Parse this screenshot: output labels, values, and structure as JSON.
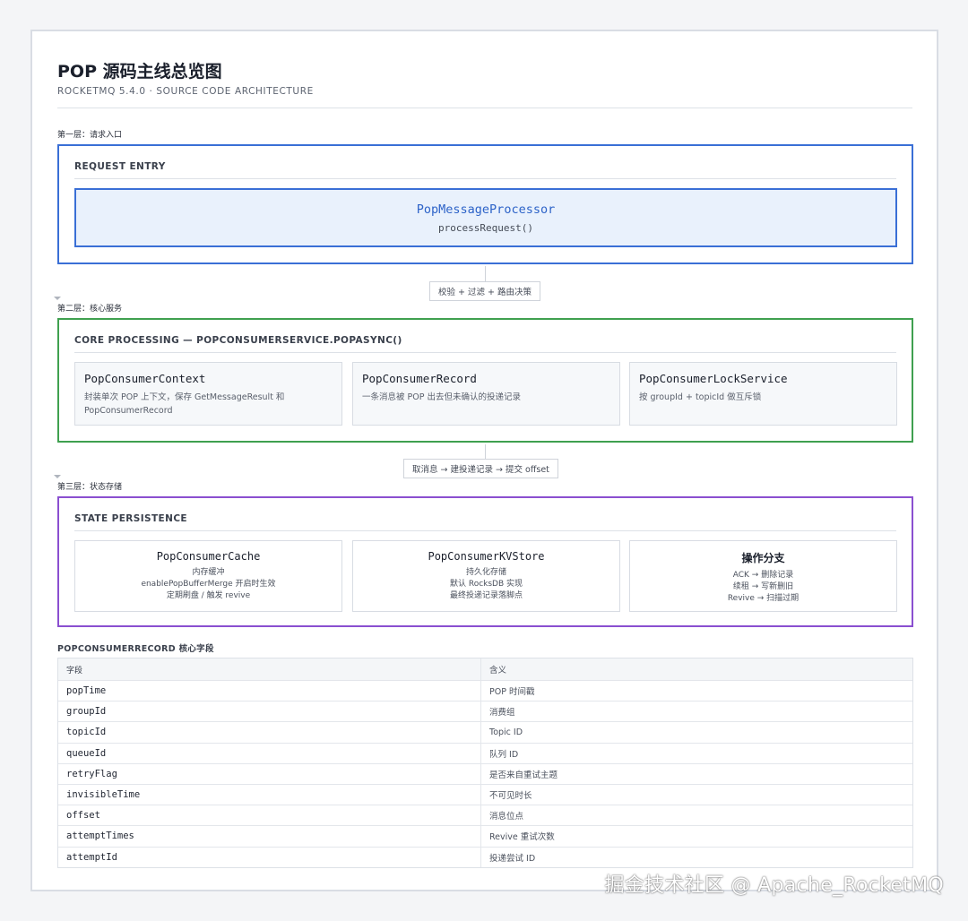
{
  "header": {
    "title": "POP 源码主线总览图",
    "subtitle": "ROCKETMQ 5.4.0 · SOURCE CODE ARCHITECTURE"
  },
  "layers": [
    {
      "label": "第一层：请求入口",
      "heading": "REQUEST ENTRY",
      "entry": {
        "name": "PopMessageProcessor",
        "method": "processRequest()"
      }
    },
    {
      "label": "第二层：核心服务",
      "heading": "CORE PROCESSING — POPCONSUMERSERVICE.POPASYNC()",
      "services": [
        {
          "name": "PopConsumerContext",
          "desc": "封装单次 POP 上下文，保存 GetMessageResult 和 PopConsumerRecord"
        },
        {
          "name": "PopConsumerRecord",
          "desc": "一条消息被 POP 出去但未确认的投递记录"
        },
        {
          "name": "PopConsumerLockService",
          "desc": "按 groupId + topicId 做互斥锁"
        }
      ]
    },
    {
      "label": "第三层：状态存储",
      "heading": "STATE PERSISTENCE",
      "stores": [
        {
          "name": "PopConsumerCache",
          "lines": [
            "内存缓冲",
            "enablePopBufferMerge 开启时生效",
            "定期刷盘 / 触发 revive"
          ]
        },
        {
          "name": "PopConsumerKVStore",
          "lines": [
            "持久化存储",
            "默认 RocksDB 实现",
            "最终投递记录落脚点"
          ]
        },
        {
          "name": "操作分支",
          "lines": [
            "ACK → 删除记录",
            "续租 → 写新删旧",
            "Revive → 扫描过期"
          ]
        }
      ]
    }
  ],
  "connectors": [
    {
      "label": "校验 + 过滤 + 路由决策"
    },
    {
      "label": "取消息 → 建投递记录 → 提交 offset"
    }
  ],
  "table": {
    "title": "POPCONSUMERRECORD 核心字段",
    "headers": [
      "字段",
      "含义"
    ],
    "rows": [
      [
        "popTime",
        "POP 时间戳"
      ],
      [
        "groupId",
        "消费组"
      ],
      [
        "topicId",
        "Topic ID"
      ],
      [
        "queueId",
        "队列 ID"
      ],
      [
        "retryFlag",
        "是否来自重试主题"
      ],
      [
        "invisibleTime",
        "不可见时长"
      ],
      [
        "offset",
        "消息位点"
      ],
      [
        "attemptTimes",
        "Revive 重试次数"
      ],
      [
        "attemptId",
        "投递尝试 ID"
      ]
    ]
  },
  "watermark": "掘金技术社区 @ Apache_RocketMQ",
  "colors": {
    "layer1": "#3a6fd6",
    "layer2": "#3fa04f",
    "layer3": "#8a4fd0"
  }
}
